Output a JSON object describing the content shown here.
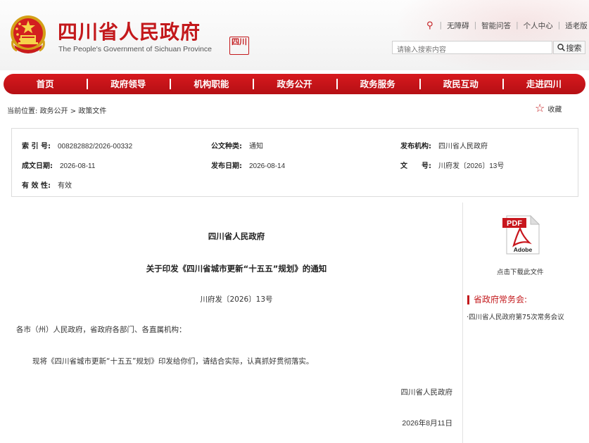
{
  "header": {
    "title": "四川省人民政府",
    "subtitle": "The People's Government of Sichuan Province",
    "seal_text": "四川",
    "top_links": [
      "无障碍",
      "智能问答",
      "个人中心",
      "适老版"
    ]
  },
  "search": {
    "placeholder": "请输入搜索内容",
    "button_label": "搜索"
  },
  "nav": {
    "items": [
      "首页",
      "政府领导",
      "机构职能",
      "政务公开",
      "政务服务",
      "政民互动",
      "走进四川"
    ]
  },
  "breadcrumb": {
    "prefix": "当前位置:",
    "items": [
      "政务公开",
      "政策文件"
    ],
    "separator": ">"
  },
  "favorite_label": "收藏",
  "meta": {
    "index_no": {
      "label": "索 引 号:",
      "value": "008282882/2026-00332"
    },
    "doc_type": {
      "label": "公文种类:",
      "value": "通知"
    },
    "issuer": {
      "label": "发布机构:",
      "value": "四川省人民政府"
    },
    "created": {
      "label": "成文日期:",
      "value": "2026-08-11"
    },
    "published": {
      "label": "发布日期:",
      "value": "2026-08-14"
    },
    "doc_no": {
      "label": "文　　号:",
      "value": "川府发〔2026〕13号"
    },
    "validity": {
      "label": "有 效 性:",
      "value": "有效"
    }
  },
  "document": {
    "issuer": "四川省人民政府",
    "title": "关于印发《四川省城市更新“十五五”规划》的通知",
    "number": "川府发〔2026〕13号",
    "address": "各市（州）人民政府，省政府各部门、各直属机构：",
    "body": "现将《四川省城市更新“十五五”规划》印发给你们，请结合实际，认真抓好贯彻落实。",
    "signature": "四川省人民政府",
    "date": "2026年8月11日"
  },
  "sidebar": {
    "pdf_label": "PDF",
    "adobe_label": "Adobe",
    "download_label": "点击下载此文件",
    "heading": "省政府常务会:",
    "link": "·四川省人民政府第75次常务会议"
  },
  "colors": {
    "brand_red": "#c3191c",
    "nav_red": "#d7191e"
  }
}
